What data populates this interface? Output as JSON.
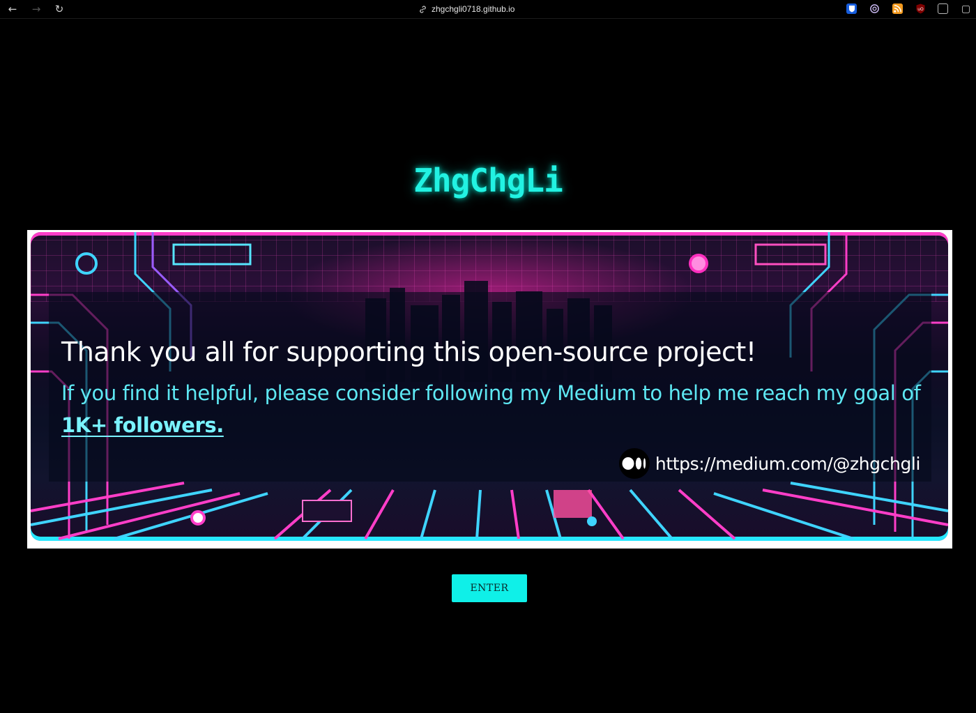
{
  "browser": {
    "url": "zhgchgli0718.github.io",
    "extensions": [
      "bitwarden-icon",
      "openai-icon",
      "rss-icon",
      "ublock-icon",
      "extensions-icon",
      "sidebar-icon"
    ]
  },
  "site": {
    "title": "ZhgChgLi"
  },
  "banner": {
    "heading": "Thank you all for supporting this open-source project!",
    "text_before_link": "If you find it helpful, please consider following my Medium to help me reach my goal of ",
    "link_text": "1K+ followers.",
    "medium_url": "https://medium.com/@zhgchgli"
  },
  "actions": {
    "enter_label": "ENTER"
  },
  "colors": {
    "accent": "#22f2e2",
    "button": "#0ff0e8",
    "pink": "#ff3ec8",
    "cyan": "#26e7ff"
  }
}
